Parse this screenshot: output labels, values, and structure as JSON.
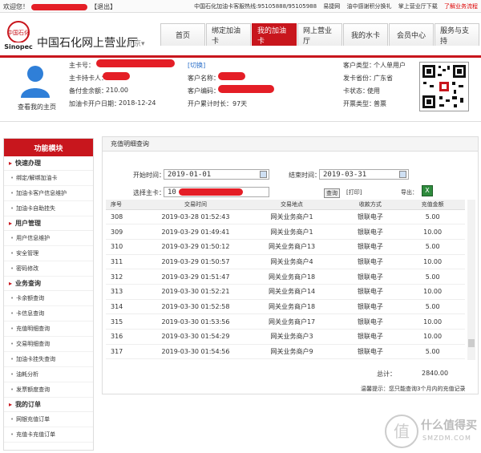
{
  "topbar": {
    "welcome": "欢迎您！",
    "logout": "【退出】",
    "links": [
      "中国石化加油卡客服热线:95105888/95105988",
      "易捷网",
      "油中感谢积分换礼",
      "掌上营业厅下载"
    ],
    "highlight_link": "了解业务流程"
  },
  "header": {
    "brand": "中国石化网上营业厅",
    "city": "北京▾",
    "nav": [
      "首页",
      "绑定加油卡",
      "我的加油卡",
      "网上营业厅",
      "我的水卡",
      "会员中心",
      "服务与支持"
    ],
    "active_nav": "我的加油卡"
  },
  "info": {
    "view_home": "查看我的主页",
    "card_no_label": "主卡号：",
    "switch": "[切换]",
    "holder_label": "主卡持卡人：",
    "balance_label": "备付金余额：",
    "balance_value": "210.00",
    "open_date_label": "加油卡开户日期：",
    "open_date_value": "2018-12-24",
    "cust_name_label": "客户名称：",
    "cust_code_label": "客户编码：",
    "duration_label": "开户累计时长：",
    "duration_value": "97天",
    "cust_type_label": "客户类型：",
    "cust_type_value": "个人单用户",
    "province_label": "发卡省份：",
    "province_value": "广东省",
    "status_label": "卡状态：",
    "status_value": "使用",
    "invoice_label": "开票类型：",
    "invoice_value": "普票"
  },
  "sidebar": {
    "title": "功能模块",
    "sections": [
      {
        "title": "快速办理",
        "items": [
          "绑定/解绑加油卡",
          "加油卡客户信息维护",
          "加油卡自助挂失"
        ]
      },
      {
        "title": "用户管理",
        "items": [
          "用户信息维护",
          "安全管理",
          "密码修改"
        ]
      },
      {
        "title": "业务查询",
        "items": [
          "卡余额查询",
          "卡信息查询",
          "充值明细查询",
          "交易明细查询",
          "加油卡挂失查询",
          "油耗分析",
          "发票额度查询"
        ]
      },
      {
        "title": "我的订单",
        "items": [
          "网银充值订单",
          "充值卡充值订单"
        ]
      }
    ]
  },
  "main": {
    "title": "充值明细查询",
    "start_label": "开始时间：",
    "start_value": "2019-01-01",
    "end_label": "结束时间：",
    "end_value": "2019-03-31",
    "card_label": "选择主卡：",
    "card_value": "10",
    "query_btn": "查询",
    "print_btn": "[打印]",
    "export_label": "导出：",
    "export_icon": "excel-icon",
    "columns": [
      "序号",
      "交易时间",
      "交易地点",
      "收款方式",
      "充值金额"
    ],
    "rows": [
      [
        "308",
        "2019-03-28 01:52:43",
        "网关业务商户1",
        "银联电子",
        "5.00"
      ],
      [
        "309",
        "2019-03-29 01:49:41",
        "网关业务商户1",
        "银联电子",
        "10.00"
      ],
      [
        "310",
        "2019-03-29 01:50:12",
        "网关业务商户13",
        "银联电子",
        "5.00"
      ],
      [
        "311",
        "2019-03-29 01:50:57",
        "网关业务商户4",
        "银联电子",
        "10.00"
      ],
      [
        "312",
        "2019-03-29 01:51:47",
        "网关业务商户18",
        "银联电子",
        "5.00"
      ],
      [
        "313",
        "2019-03-30 01:52:21",
        "网关业务商户14",
        "银联电子",
        "10.00"
      ],
      [
        "314",
        "2019-03-30 01:52:58",
        "网关业务商户18",
        "银联电子",
        "5.00"
      ],
      [
        "315",
        "2019-03-30 01:53:56",
        "网关业务商户17",
        "银联电子",
        "10.00"
      ],
      [
        "316",
        "2019-03-30 01:54:29",
        "网关业务商户3",
        "银联电子",
        "10.00"
      ],
      [
        "317",
        "2019-03-30 01:54:56",
        "网关业务商户9",
        "银联电子",
        "5.00"
      ]
    ],
    "total_label": "总计：",
    "total_value": "2840.00",
    "tip": "温馨提示：您只能查询3个月内的充值记录"
  },
  "watermark": {
    "text": "什么值得买",
    "sub": "SMZDM.COM"
  },
  "colors": {
    "brand_red": "#c8161d",
    "redact": "#e41e26"
  }
}
